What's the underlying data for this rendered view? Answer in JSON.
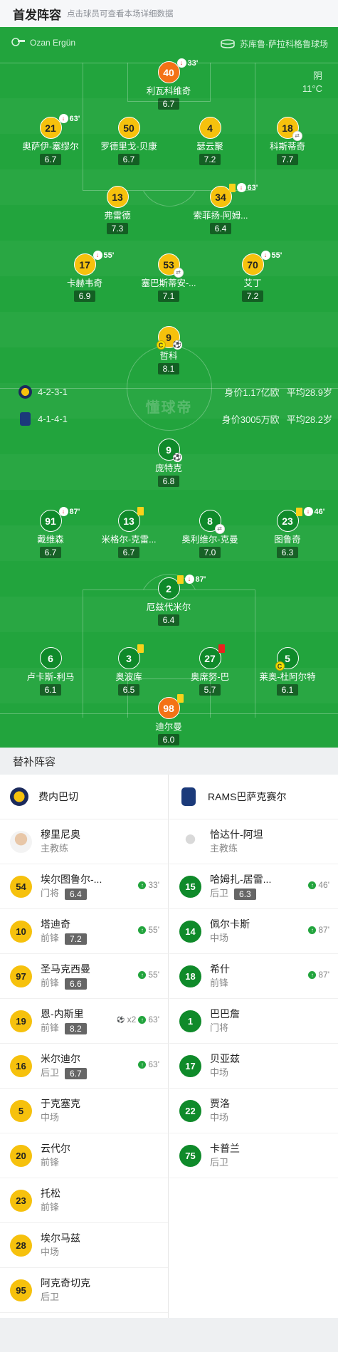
{
  "header": {
    "title": "首发阵容",
    "subtitle": "点击球员可查看本场详细数据"
  },
  "match": {
    "referee": "Ozan Ergün",
    "stadium": "苏库鲁·萨拉科格鲁球场",
    "weather": "阴",
    "temperature": "11°C",
    "watermark": "懂球帝"
  },
  "home_team": {
    "name": "费内巴切",
    "formation": "4-2-3-1",
    "value_text": "身价1.17亿欧",
    "age_text": "平均28.9岁",
    "color": "#f6c10d"
  },
  "away_team": {
    "name": "RAMS巴萨克赛尔",
    "formation": "4-1-4-1",
    "value_text": "身价3005万欧",
    "age_text": "平均28.2岁",
    "color": "#0f8a2a"
  },
  "home_players": [
    {
      "num": "40",
      "name": "利瓦科维奇",
      "rating": "6.7",
      "sub_out": "33'",
      "orange": true
    },
    {
      "num": "21",
      "name": "奥萨伊-塞缪尔",
      "rating": "6.7",
      "sub_out": "63'"
    },
    {
      "num": "50",
      "name": "罗德里戈-贝康",
      "rating": "6.7"
    },
    {
      "num": "4",
      "name": "瑟云聚",
      "rating": "7.2"
    },
    {
      "num": "18",
      "name": "科斯蒂奇",
      "rating": "7.7"
    },
    {
      "num": "13",
      "name": "弗雷德",
      "rating": "7.3"
    },
    {
      "num": "34",
      "name": "索菲扬-阿姆...",
      "rating": "6.4",
      "sub_out": "63'"
    },
    {
      "num": "17",
      "name": "卡赫韦奇",
      "rating": "6.9",
      "sub_out": "55'"
    },
    {
      "num": "53",
      "name": "塞巴斯蒂安-...",
      "rating": "7.1"
    },
    {
      "num": "70",
      "name": "艾丁",
      "rating": "7.2",
      "sub_out": "55'"
    },
    {
      "num": "9",
      "name": "哲科",
      "rating": "8.1"
    }
  ],
  "away_players": [
    {
      "num": "9",
      "name": "庞特克",
      "rating": "6.8"
    },
    {
      "num": "91",
      "name": "戴维森",
      "rating": "6.7",
      "sub_out": "87'"
    },
    {
      "num": "13",
      "name": "米格尔-克雷...",
      "rating": "6.7"
    },
    {
      "num": "8",
      "name": "奥利维尔-克曼",
      "rating": "7.0"
    },
    {
      "num": "23",
      "name": "图鲁奇",
      "rating": "6.3",
      "sub_out": "46'"
    },
    {
      "num": "2",
      "name": "厄兹代米尔",
      "rating": "6.4",
      "sub_out": "87'"
    },
    {
      "num": "6",
      "name": "卢卡斯-利马",
      "rating": "6.1"
    },
    {
      "num": "3",
      "name": "奥波库",
      "rating": "6.5"
    },
    {
      "num": "27",
      "name": "奥席努-巴",
      "rating": "5.7"
    },
    {
      "num": "5",
      "name": "莱奥-杜阿尔特",
      "rating": "6.1"
    },
    {
      "num": "98",
      "name": "迪尔曼",
      "rating": "6.0",
      "orange": true
    }
  ],
  "subs_title": "替补阵容",
  "home_coach": {
    "name": "穆里尼奥",
    "role": "主教练"
  },
  "away_coach": {
    "name": "恰达什-阿坦",
    "role": "主教练"
  },
  "home_subs": [
    {
      "num": "54",
      "name": "埃尔图鲁尔-...",
      "pos": "门将",
      "rating": "6.4",
      "time": "33'"
    },
    {
      "num": "10",
      "name": "塔迪奇",
      "pos": "前锋",
      "rating": "7.2",
      "time": "55'"
    },
    {
      "num": "97",
      "name": "圣马克西曼",
      "pos": "前锋",
      "rating": "6.6",
      "time": "55'"
    },
    {
      "num": "19",
      "name": "恩-内斯里",
      "pos": "前锋",
      "rating": "8.2",
      "time": "63'",
      "goals": "x2"
    },
    {
      "num": "16",
      "name": "米尔迪尔",
      "pos": "后卫",
      "rating": "6.7",
      "time": "63'"
    },
    {
      "num": "5",
      "name": "于克塞克",
      "pos": "中场"
    },
    {
      "num": "20",
      "name": "云代尔",
      "pos": "前锋"
    },
    {
      "num": "23",
      "name": "托松",
      "pos": "前锋"
    },
    {
      "num": "28",
      "name": "埃尔马兹",
      "pos": "中场"
    },
    {
      "num": "95",
      "name": "阿克奇切克",
      "pos": "后卫"
    }
  ],
  "away_subs": [
    {
      "num": "15",
      "name": "哈姆扎-居雷...",
      "pos": "后卫",
      "rating": "6.3",
      "time": "46'"
    },
    {
      "num": "14",
      "name": "佩尔卡斯",
      "pos": "中场",
      "time": "87'"
    },
    {
      "num": "18",
      "name": "希什",
      "pos": "前锋",
      "time": "87'"
    },
    {
      "num": "1",
      "name": "巴巴詹",
      "pos": "门将"
    },
    {
      "num": "17",
      "name": "贝亚兹",
      "pos": "中场"
    },
    {
      "num": "22",
      "name": "贾洛",
      "pos": "中场"
    },
    {
      "num": "75",
      "name": "卡普兰",
      "pos": "后卫"
    }
  ]
}
